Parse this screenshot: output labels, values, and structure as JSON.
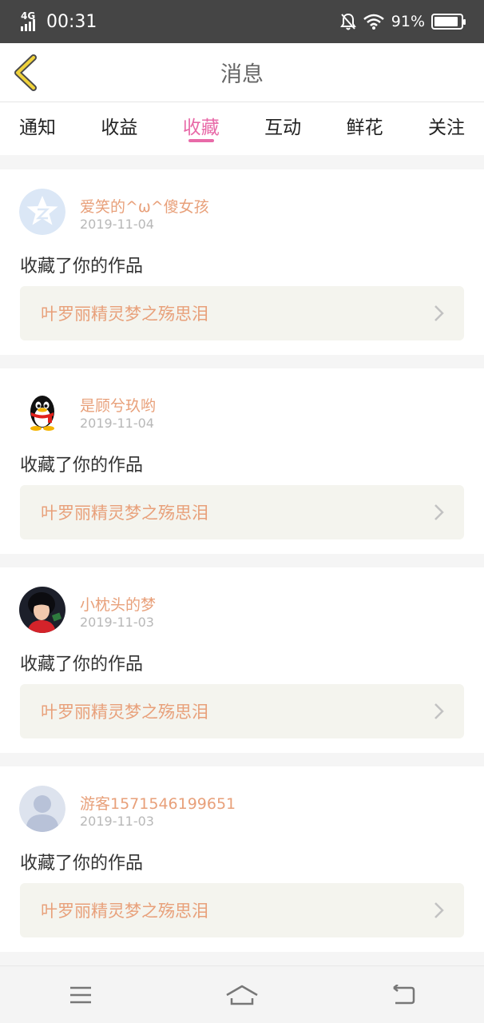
{
  "status_bar": {
    "network": "4G",
    "time": "00:31",
    "battery_pct": "91%",
    "battery_level": 0.91,
    "icons": [
      "signal-icon",
      "mute-bell-icon",
      "wifi-icon",
      "battery-icon"
    ]
  },
  "header": {
    "title": "消息",
    "back_icon": "chevron-left-icon"
  },
  "tabs": [
    {
      "label": "通知",
      "active": false
    },
    {
      "label": "收益",
      "active": false
    },
    {
      "label": "收藏",
      "active": true
    },
    {
      "label": "互动",
      "active": false
    },
    {
      "label": "鲜花",
      "active": false
    },
    {
      "label": "关注",
      "active": false
    }
  ],
  "colors": {
    "accent": "#e86aa8",
    "name": "#e8a07a",
    "status_bar": "#454545"
  },
  "items": [
    {
      "name": "爱笑的^ω^傻女孩",
      "date": "2019-11-04",
      "action": "收藏了你的作品",
      "work": "叶罗丽精灵梦之殇思泪",
      "avatar": "qzone-avatar"
    },
    {
      "name": "是顾兮玖哟",
      "date": "2019-11-04",
      "action": "收藏了你的作品",
      "work": "叶罗丽精灵梦之殇思泪",
      "avatar": "qq-penguin-avatar"
    },
    {
      "name": "小枕头的梦",
      "date": "2019-11-03",
      "action": "收藏了你的作品",
      "work": "叶罗丽精灵梦之殇思泪",
      "avatar": "photo-avatar"
    },
    {
      "name": "游客1571546199651",
      "date": "2019-11-03",
      "action": "收藏了你的作品",
      "work": "叶罗丽精灵梦之殇思泪",
      "avatar": "default-person-avatar"
    }
  ],
  "bottom_nav": {
    "icons": [
      "menu-icon",
      "home-icon",
      "back-icon"
    ]
  }
}
